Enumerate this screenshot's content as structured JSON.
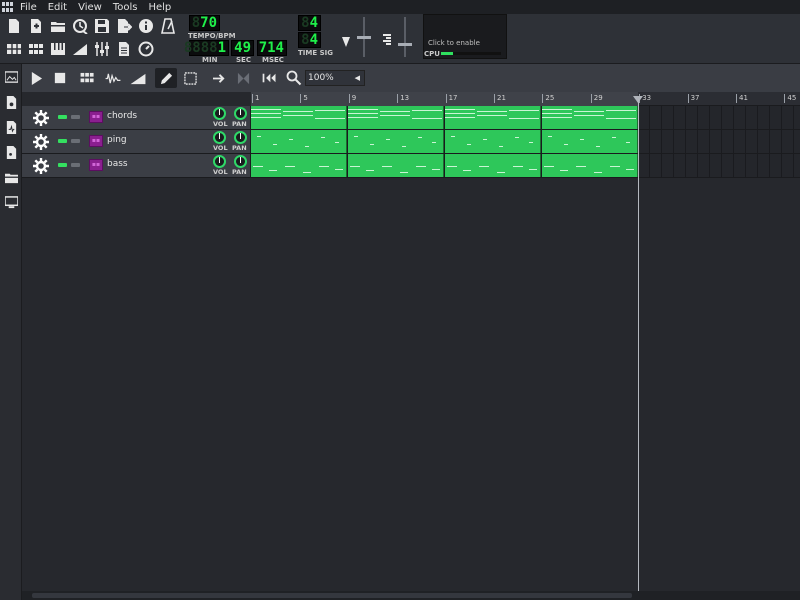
{
  "menubar": {
    "items": [
      "File",
      "Edit",
      "View",
      "Tools",
      "Help"
    ]
  },
  "transport": {
    "tempo": "70",
    "tempo_label": "TEMPO/BPM",
    "min": "1",
    "sec": "49",
    "msec": "714",
    "min_label": "MIN",
    "sec_label": "SEC",
    "msec_label": "MSEC",
    "timesig_num": "4",
    "timesig_den": "4",
    "timesig_label": "TIME SIG"
  },
  "cpu": {
    "hint": "Click to enable",
    "label": "CPU",
    "load": 0.2
  },
  "song_editor": {
    "zoom": "100%",
    "timeline_bars": [
      "1",
      "5",
      "9",
      "13",
      "17",
      "21",
      "25",
      "29",
      "33",
      "37",
      "41",
      "45"
    ],
    "tracks": [
      {
        "name": "chords",
        "vol_label": "VOL",
        "pan_label": "PAN"
      },
      {
        "name": "ping",
        "vol_label": "VOL",
        "pan_label": "PAN"
      },
      {
        "name": "bass",
        "vol_label": "VOL",
        "pan_label": "PAN"
      }
    ]
  },
  "colors": {
    "clip": "#2ec75a",
    "lcd_text": "#1ff04a",
    "instrument": "#8a1f8f"
  },
  "icons": {
    "toolbar": [
      "new-project-icon",
      "new-from-template-icon",
      "open-project-icon",
      "recent-projects-icon",
      "save-icon",
      "export-icon",
      "whats-this-icon",
      "metronome-icon",
      "song-editor-icon",
      "beat-bassline-icon",
      "piano-roll-icon",
      "automation-editor-icon",
      "mixer-icon",
      "project-notes-icon",
      "controller-rack-icon"
    ],
    "song_toolbar": [
      "play-icon",
      "stop-icon",
      "add-beat-bassline-icon",
      "add-sample-track-icon",
      "add-automation-track-icon",
      "draw-mode-icon",
      "edit-mode-icon",
      "auto-scroll-icon",
      "loop-points-icon",
      "stop-behaviour-icon",
      "zoom-icon"
    ]
  }
}
